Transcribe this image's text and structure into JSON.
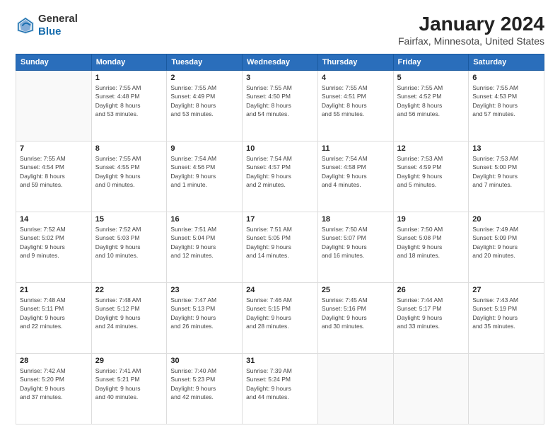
{
  "header": {
    "logo_line1": "General",
    "logo_line2": "Blue",
    "title": "January 2024",
    "subtitle": "Fairfax, Minnesota, United States"
  },
  "columns": [
    "Sunday",
    "Monday",
    "Tuesday",
    "Wednesday",
    "Thursday",
    "Friday",
    "Saturday"
  ],
  "weeks": [
    [
      {
        "day": "",
        "info": ""
      },
      {
        "day": "1",
        "info": "Sunrise: 7:55 AM\nSunset: 4:48 PM\nDaylight: 8 hours\nand 53 minutes."
      },
      {
        "day": "2",
        "info": "Sunrise: 7:55 AM\nSunset: 4:49 PM\nDaylight: 8 hours\nand 53 minutes."
      },
      {
        "day": "3",
        "info": "Sunrise: 7:55 AM\nSunset: 4:50 PM\nDaylight: 8 hours\nand 54 minutes."
      },
      {
        "day": "4",
        "info": "Sunrise: 7:55 AM\nSunset: 4:51 PM\nDaylight: 8 hours\nand 55 minutes."
      },
      {
        "day": "5",
        "info": "Sunrise: 7:55 AM\nSunset: 4:52 PM\nDaylight: 8 hours\nand 56 minutes."
      },
      {
        "day": "6",
        "info": "Sunrise: 7:55 AM\nSunset: 4:53 PM\nDaylight: 8 hours\nand 57 minutes."
      }
    ],
    [
      {
        "day": "7",
        "info": "Sunrise: 7:55 AM\nSunset: 4:54 PM\nDaylight: 8 hours\nand 59 minutes."
      },
      {
        "day": "8",
        "info": "Sunrise: 7:55 AM\nSunset: 4:55 PM\nDaylight: 9 hours\nand 0 minutes."
      },
      {
        "day": "9",
        "info": "Sunrise: 7:54 AM\nSunset: 4:56 PM\nDaylight: 9 hours\nand 1 minute."
      },
      {
        "day": "10",
        "info": "Sunrise: 7:54 AM\nSunset: 4:57 PM\nDaylight: 9 hours\nand 2 minutes."
      },
      {
        "day": "11",
        "info": "Sunrise: 7:54 AM\nSunset: 4:58 PM\nDaylight: 9 hours\nand 4 minutes."
      },
      {
        "day": "12",
        "info": "Sunrise: 7:53 AM\nSunset: 4:59 PM\nDaylight: 9 hours\nand 5 minutes."
      },
      {
        "day": "13",
        "info": "Sunrise: 7:53 AM\nSunset: 5:00 PM\nDaylight: 9 hours\nand 7 minutes."
      }
    ],
    [
      {
        "day": "14",
        "info": "Sunrise: 7:52 AM\nSunset: 5:02 PM\nDaylight: 9 hours\nand 9 minutes."
      },
      {
        "day": "15",
        "info": "Sunrise: 7:52 AM\nSunset: 5:03 PM\nDaylight: 9 hours\nand 10 minutes."
      },
      {
        "day": "16",
        "info": "Sunrise: 7:51 AM\nSunset: 5:04 PM\nDaylight: 9 hours\nand 12 minutes."
      },
      {
        "day": "17",
        "info": "Sunrise: 7:51 AM\nSunset: 5:05 PM\nDaylight: 9 hours\nand 14 minutes."
      },
      {
        "day": "18",
        "info": "Sunrise: 7:50 AM\nSunset: 5:07 PM\nDaylight: 9 hours\nand 16 minutes."
      },
      {
        "day": "19",
        "info": "Sunrise: 7:50 AM\nSunset: 5:08 PM\nDaylight: 9 hours\nand 18 minutes."
      },
      {
        "day": "20",
        "info": "Sunrise: 7:49 AM\nSunset: 5:09 PM\nDaylight: 9 hours\nand 20 minutes."
      }
    ],
    [
      {
        "day": "21",
        "info": "Sunrise: 7:48 AM\nSunset: 5:11 PM\nDaylight: 9 hours\nand 22 minutes."
      },
      {
        "day": "22",
        "info": "Sunrise: 7:48 AM\nSunset: 5:12 PM\nDaylight: 9 hours\nand 24 minutes."
      },
      {
        "day": "23",
        "info": "Sunrise: 7:47 AM\nSunset: 5:13 PM\nDaylight: 9 hours\nand 26 minutes."
      },
      {
        "day": "24",
        "info": "Sunrise: 7:46 AM\nSunset: 5:15 PM\nDaylight: 9 hours\nand 28 minutes."
      },
      {
        "day": "25",
        "info": "Sunrise: 7:45 AM\nSunset: 5:16 PM\nDaylight: 9 hours\nand 30 minutes."
      },
      {
        "day": "26",
        "info": "Sunrise: 7:44 AM\nSunset: 5:17 PM\nDaylight: 9 hours\nand 33 minutes."
      },
      {
        "day": "27",
        "info": "Sunrise: 7:43 AM\nSunset: 5:19 PM\nDaylight: 9 hours\nand 35 minutes."
      }
    ],
    [
      {
        "day": "28",
        "info": "Sunrise: 7:42 AM\nSunset: 5:20 PM\nDaylight: 9 hours\nand 37 minutes."
      },
      {
        "day": "29",
        "info": "Sunrise: 7:41 AM\nSunset: 5:21 PM\nDaylight: 9 hours\nand 40 minutes."
      },
      {
        "day": "30",
        "info": "Sunrise: 7:40 AM\nSunset: 5:23 PM\nDaylight: 9 hours\nand 42 minutes."
      },
      {
        "day": "31",
        "info": "Sunrise: 7:39 AM\nSunset: 5:24 PM\nDaylight: 9 hours\nand 44 minutes."
      },
      {
        "day": "",
        "info": ""
      },
      {
        "day": "",
        "info": ""
      },
      {
        "day": "",
        "info": ""
      }
    ]
  ]
}
